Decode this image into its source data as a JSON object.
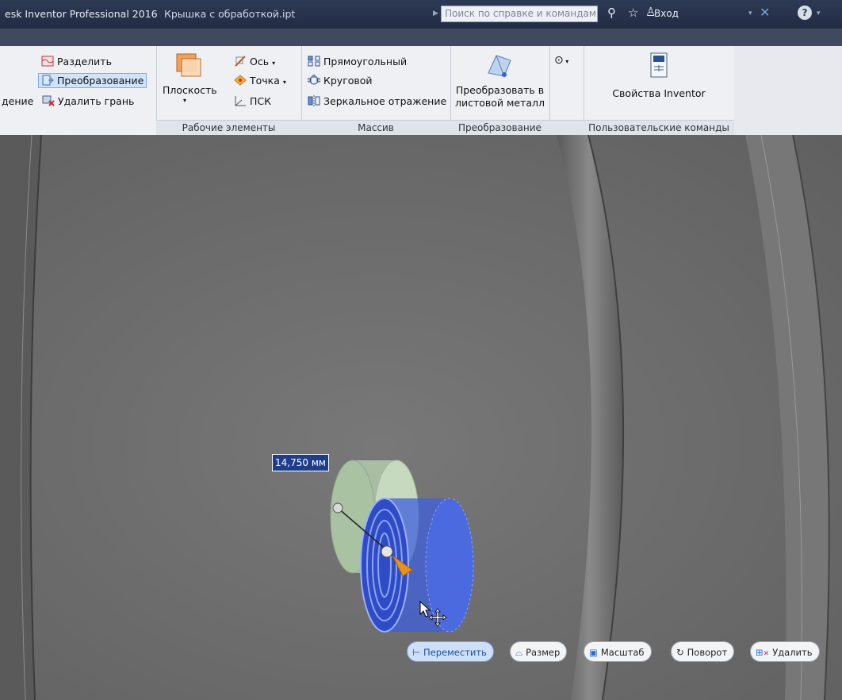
{
  "titlebar": {
    "app_title": "esk Inventor Professional 2016",
    "document": "Крышка с обработкой.ipt",
    "search_placeholder": "Поиск по справке и командам.",
    "login": "Вход"
  },
  "ribbon": {
    "modify": {
      "split": "Разделить",
      "convert": "Преобразование",
      "partial_left": "дение",
      "delete_face": "Удалить грань"
    },
    "work_features": {
      "plane": "Плоскость",
      "axis": "Ось",
      "point": "Точка",
      "ucs": "ПСК",
      "title": "Рабочие элементы"
    },
    "pattern": {
      "rect": "Прямоугольный",
      "circular": "Круговой",
      "mirror": "Зеркальное отражение",
      "title": "Массив"
    },
    "convert_panel": {
      "sheet_metal_line1": "Преобразовать в",
      "sheet_metal_line2": "листовой металл",
      "title": "Преобразование"
    },
    "user_commands": {
      "inventor_props": "Свойства Inventor",
      "title": "Пользовательские команды"
    }
  },
  "viewport": {
    "dimension_value": "14,750 мм"
  },
  "minitoolbar": {
    "move": "Переместить",
    "size": "Размер",
    "scale": "Масштаб",
    "rotate": "Поворот",
    "delete": "Удалить"
  },
  "colors": {
    "titlebar": "#2d3a55",
    "ribbon": "#eef0f4",
    "viewport": "#6e6e6e",
    "highlight": "#cfe3fb",
    "accent_blue": "#3a5fd8"
  }
}
